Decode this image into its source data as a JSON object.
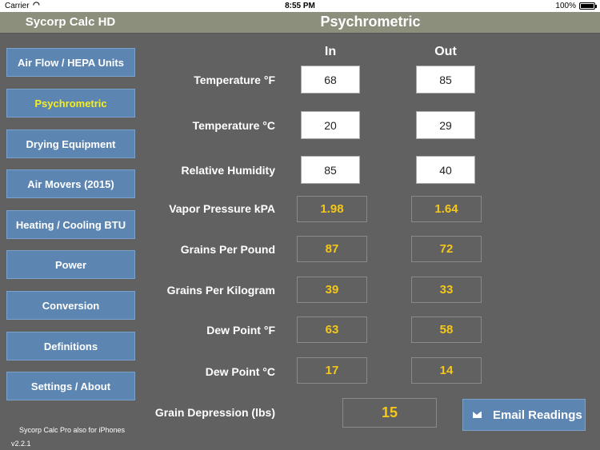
{
  "status_bar": {
    "carrier": "Carrier",
    "time": "8:55 PM",
    "battery": "100%"
  },
  "header": {
    "app_title": "Sycorp Calc HD",
    "page_title": "Psychrometric"
  },
  "sidebar": {
    "items": [
      {
        "label": "Air Flow / HEPA Units",
        "active": false
      },
      {
        "label": "Psychrometric",
        "active": true
      },
      {
        "label": "Drying Equipment",
        "active": false
      },
      {
        "label": "Air Movers (2015)",
        "active": false
      },
      {
        "label": "Heating / Cooling BTU",
        "active": false
      },
      {
        "label": "Power",
        "active": false
      },
      {
        "label": "Conversion",
        "active": false
      },
      {
        "label": "Definitions",
        "active": false
      },
      {
        "label": "Settings / About",
        "active": false
      }
    ],
    "note": "Sycorp Calc Pro also for iPhones",
    "version": "v2.2.1"
  },
  "columns": {
    "in": "In",
    "out": "Out"
  },
  "inputs": {
    "temp_f": {
      "label": "Temperature °F",
      "in": "68",
      "out": "85"
    },
    "temp_c": {
      "label": "Temperature °C",
      "in": "20",
      "out": "29"
    },
    "rh": {
      "label": "Relative Humidity",
      "in": "85",
      "out": "40"
    }
  },
  "outputs": {
    "vapor_pressure": {
      "label": "Vapor Pressure kPA",
      "in": "1.98",
      "out": "1.64"
    },
    "grains_lb": {
      "label": "Grains Per Pound",
      "in": "87",
      "out": "72"
    },
    "grains_kg": {
      "label": "Grains Per Kilogram",
      "in": "39",
      "out": "33"
    },
    "dew_f": {
      "label": "Dew Point °F",
      "in": "63",
      "out": "58"
    },
    "dew_c": {
      "label": "Dew Point °C",
      "in": "17",
      "out": "14"
    }
  },
  "grain_depression": {
    "label": "Grain Depression (lbs)",
    "value": "15"
  },
  "email_button": {
    "label": "Email Readings"
  },
  "colors": {
    "background": "#616161",
    "header": "#8c8f7c",
    "button": "#5d85b1",
    "active_text": "#f5ef1f",
    "output_text": "#f5c719"
  }
}
